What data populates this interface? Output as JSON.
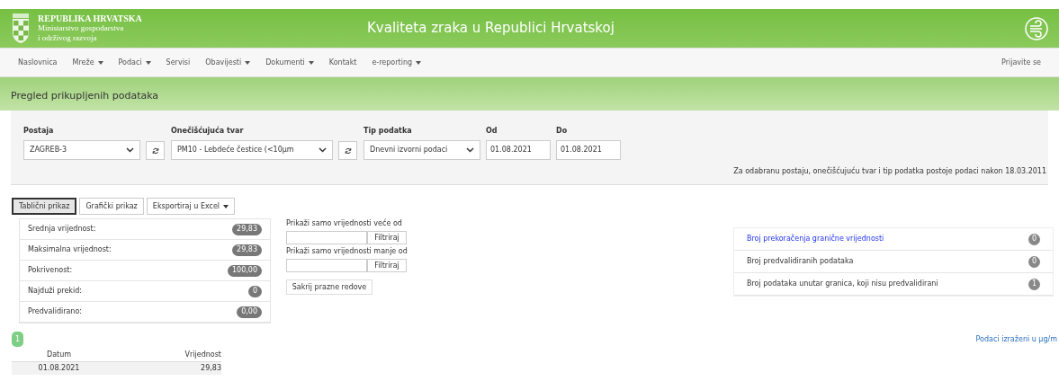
{
  "header": {
    "country": "REPUBLIKA HRVATSKA",
    "ministry_line_1": "Ministarstvo gospodarstva",
    "ministry_line_2": "i održivog razvoja",
    "title": "Kvaliteta zraka u Republici Hrvatskoj"
  },
  "nav": {
    "items": [
      {
        "label": "Naslovnica",
        "dropdown": false
      },
      {
        "label": "Mreže",
        "dropdown": true
      },
      {
        "label": "Podaci",
        "dropdown": true
      },
      {
        "label": "Servisi",
        "dropdown": false
      },
      {
        "label": "Obavijesti",
        "dropdown": true
      },
      {
        "label": "Dokumenti",
        "dropdown": true
      },
      {
        "label": "Kontakt",
        "dropdown": false
      },
      {
        "label": "e-reporting",
        "dropdown": true
      }
    ],
    "login": "Prijavite se"
  },
  "page_title": "Pregled prikupljenih podataka",
  "filters": {
    "fields": [
      {
        "kind": "select",
        "label": "Postaja",
        "value": "ZAGREB-3",
        "refresh": true
      },
      {
        "kind": "select",
        "label": "Onečišćujuća tvar",
        "value": "PM10 - Lebdeće čestice (<10µm",
        "refresh": true
      },
      {
        "kind": "select",
        "label": "Tip podatka",
        "value": "Dnevni izvorni podaci",
        "refresh": false
      },
      {
        "kind": "date",
        "label": "Od",
        "value": "01.08.2021",
        "refresh": false
      },
      {
        "kind": "date",
        "label": "Do",
        "value": "01.08.2021",
        "refresh": false
      }
    ],
    "note": "Za odabranu postaju, onečišćujuću tvar i tip podatka postoje podaci nakon 18.03.2011"
  },
  "view_buttons": [
    {
      "label": "Tablični prikaz",
      "selected": true,
      "dropdown": false
    },
    {
      "label": "Grafički prikaz",
      "selected": false,
      "dropdown": false
    },
    {
      "label": "Eksportiraj u Excel",
      "selected": false,
      "dropdown": true
    }
  ],
  "stats": [
    {
      "label": "Srednja vrijednost:",
      "value": "29,83"
    },
    {
      "label": "Maksimalna vrijednost:",
      "value": "29,83"
    },
    {
      "label": "Pokrivenost:",
      "value": "100,00"
    },
    {
      "label": "Najduži prekid:",
      "value": "0"
    },
    {
      "label": "Predvalidirano:",
      "value": "0,00"
    }
  ],
  "value_filters": [
    {
      "label": "Prikaži samo vrijednosti veće od",
      "button": "Filtriraj"
    },
    {
      "label": "Prikaži samo vrijednosti manje od",
      "button": "Filtriraj"
    }
  ],
  "hide_empty_button": "Sakrij prazne redove",
  "counts": [
    {
      "label": "Broj prekoračenja granične vrijednosti",
      "value": "0",
      "link": true
    },
    {
      "label": "Broj predvalidiranih podataka",
      "value": "0",
      "link": false
    },
    {
      "label": "Broj podataka unutar granica, koji nisu predvalidirani",
      "value": "1",
      "link": false
    }
  ],
  "pagination": [
    {
      "label": "1",
      "selected": true
    }
  ],
  "units_note": "Podaci izraženi u µg/m",
  "table": {
    "columns": [
      "Datum",
      "Vrijednost"
    ],
    "rows": [
      [
        "01.08.2021",
        "29,83"
      ]
    ]
  }
}
